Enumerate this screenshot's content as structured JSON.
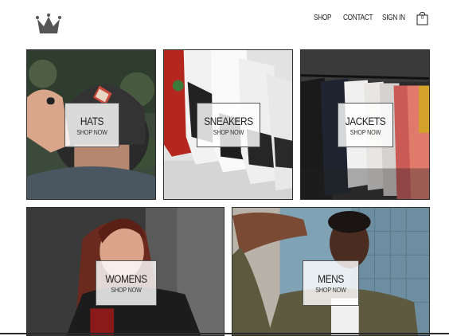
{
  "nav": {
    "shop": "SHOP",
    "contact": "CONTACT",
    "sign_in": "SIGN IN",
    "cart_count": "0"
  },
  "icons": {
    "logo": "crown-icon",
    "cart": "shopping-bag-icon"
  },
  "categories": [
    {
      "title": "HATS",
      "cta": "SHOP NOW"
    },
    {
      "title": "SNEAKERS",
      "cta": "SHOP NOW"
    },
    {
      "title": "JACKETS",
      "cta": "SHOP NOW"
    },
    {
      "title": "WOMENS",
      "cta": "SHOP NOW"
    },
    {
      "title": "MENS",
      "cta": "SHOP NOW"
    }
  ]
}
